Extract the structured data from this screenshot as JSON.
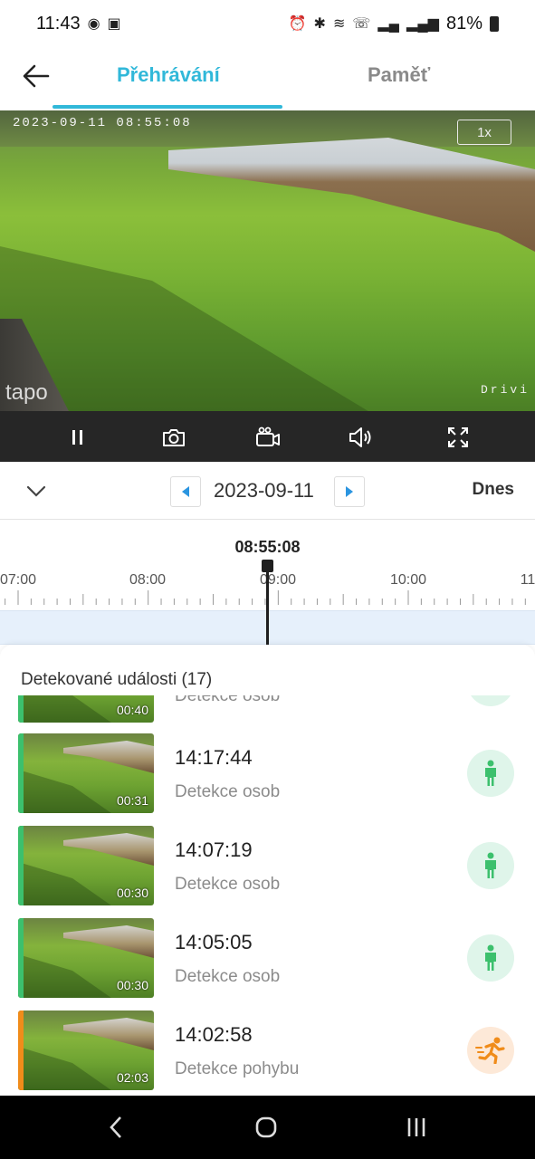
{
  "status_bar": {
    "time": "11:43",
    "battery": "81%"
  },
  "header": {
    "tabs": [
      {
        "label": "Přehrávání",
        "active": true
      },
      {
        "label": "Paměť",
        "active": false
      }
    ],
    "accent_color": "#31b8d9"
  },
  "video": {
    "osd_timestamp": "2023-09-11  08:55:08",
    "zoom": "1x",
    "brand": "tapo",
    "osd_right": "Drivi"
  },
  "controls": [
    "pause-icon",
    "camera-icon",
    "video-record-icon",
    "speaker-icon",
    "fullscreen-icon"
  ],
  "date_row": {
    "date": "2023-09-11",
    "today_label": "Dnes"
  },
  "timeline": {
    "current_time": "08:55:08",
    "hour_labels": [
      "07:00",
      "08:00",
      "09:00",
      "10:00",
      "11"
    ]
  },
  "events": {
    "header": "Detekované události (17)",
    "items": [
      {
        "time": "",
        "type": "Detekce osob",
        "duration": "00:40",
        "kind": "person",
        "partial": true
      },
      {
        "time": "14:17:44",
        "type": "Detekce osob",
        "duration": "00:31",
        "kind": "person"
      },
      {
        "time": "14:07:19",
        "type": "Detekce osob",
        "duration": "00:30",
        "kind": "person"
      },
      {
        "time": "14:05:05",
        "type": "Detekce osob",
        "duration": "00:30",
        "kind": "person"
      },
      {
        "time": "14:02:58",
        "type": "Detekce pohybu",
        "duration": "02:03",
        "kind": "motion"
      }
    ],
    "colors": {
      "person": "#3cc06d",
      "motion": "#f08c1a"
    }
  }
}
